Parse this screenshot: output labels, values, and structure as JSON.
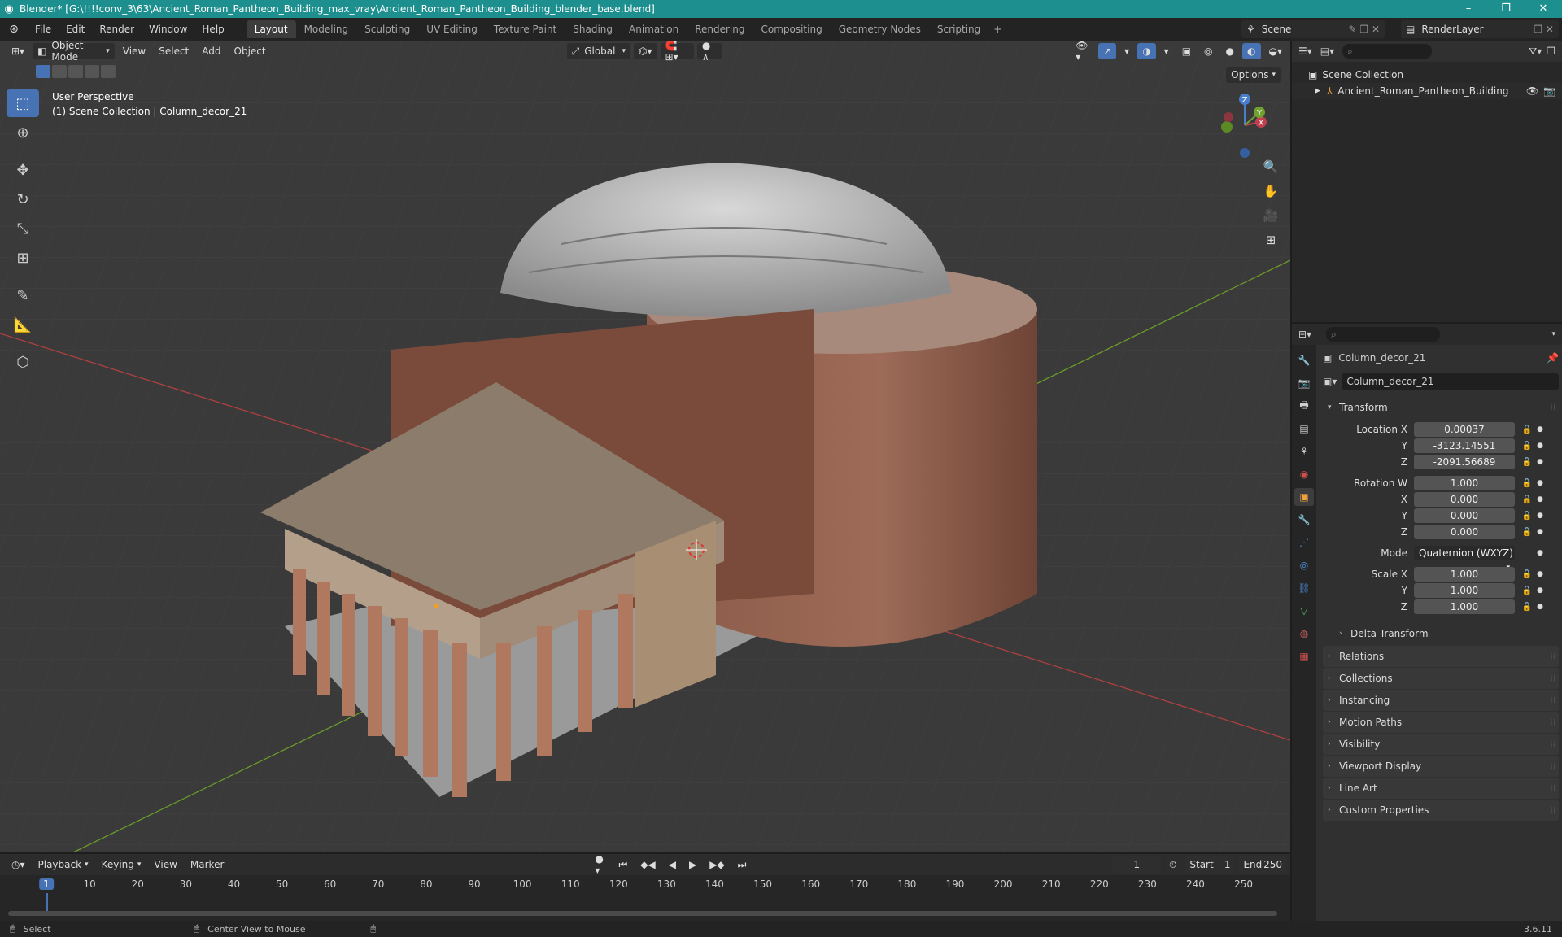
{
  "window": {
    "title": "Blender* [G:\\!!!!conv_3\\63\\Ancient_Roman_Pantheon_Building_max_vray\\Ancient_Roman_Pantheon_Building_blender_base.blend]"
  },
  "menu": {
    "items": [
      "File",
      "Edit",
      "Render",
      "Window",
      "Help"
    ]
  },
  "workspaces": [
    "Layout",
    "Modeling",
    "Sculpting",
    "UV Editing",
    "Texture Paint",
    "Shading",
    "Animation",
    "Rendering",
    "Compositing",
    "Geometry Nodes",
    "Scripting"
  ],
  "scene": {
    "name": "Scene",
    "view_layer": "RenderLayer"
  },
  "viewport": {
    "mode": "Object Mode",
    "menus": [
      "View",
      "Select",
      "Add",
      "Object"
    ],
    "orientation": "Global",
    "options_label": "Options",
    "view_name": "User Perspective",
    "context_line": "(1) Scene Collection | Column_decor_21",
    "gizmo": {
      "x": "X",
      "y": "Y",
      "z": "Z"
    }
  },
  "outliner": {
    "root": "Scene Collection",
    "children": [
      "Ancient_Roman_Pantheon_Building"
    ]
  },
  "properties": {
    "object_name": "Column_decor_21",
    "data_name": "Column_decor_21",
    "transform_title": "Transform",
    "location": {
      "label": "Location X",
      "x": "0.00037",
      "y": "-3123.14551",
      "z": "-2091.56689"
    },
    "rotation": {
      "label": "Rotation W",
      "w": "1.000",
      "x": "0.000",
      "y": "0.000",
      "z": "0.000"
    },
    "mode_label": "Mode",
    "mode_value": "Quaternion (WXYZ)",
    "scale": {
      "label": "Scale X",
      "x": "1.000",
      "y": "1.000",
      "z": "1.000"
    },
    "axis_labels": {
      "x": "X",
      "y": "Y",
      "z": "Z"
    },
    "delta_transform": "Delta Transform",
    "panels": [
      "Relations",
      "Collections",
      "Instancing",
      "Motion Paths",
      "Visibility",
      "Viewport Display",
      "Line Art",
      "Custom Properties"
    ]
  },
  "timeline": {
    "menus": [
      "Playback",
      "Keying",
      "View",
      "Marker"
    ],
    "current_frame": "1",
    "start_label": "Start",
    "start": "1",
    "end_label": "End",
    "end": "250",
    "ticks": [
      "10",
      "20",
      "30",
      "40",
      "50",
      "60",
      "70",
      "80",
      "90",
      "100",
      "110",
      "120",
      "130",
      "140",
      "150",
      "160",
      "170",
      "180",
      "190",
      "200",
      "210",
      "220",
      "230",
      "240",
      "250"
    ],
    "frame_marker": "1"
  },
  "status": {
    "left": "Select",
    "middle": "Center View to Mouse",
    "version": "3.6.11"
  },
  "colors": {
    "accent": "#4772b3",
    "titlebar": "#1e8f8f",
    "grid_x": "#b04040",
    "grid_y": "#6a9a2a"
  }
}
